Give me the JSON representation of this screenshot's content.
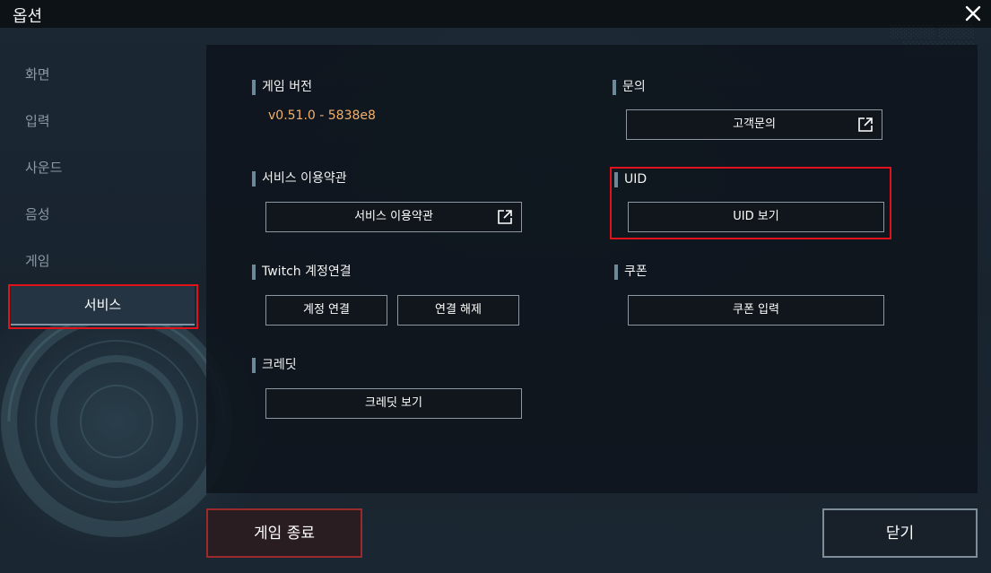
{
  "window": {
    "title": "옵션",
    "watermark_lines": [
      "░░░░░ ░░░░",
      "░░░░░░░░"
    ]
  },
  "sidebar": {
    "items": [
      {
        "label": "화면"
      },
      {
        "label": "입력"
      },
      {
        "label": "사운드"
      },
      {
        "label": "음성"
      },
      {
        "label": "게임"
      },
      {
        "label": "서비스",
        "active": true
      }
    ]
  },
  "main": {
    "game_version": {
      "label": "게임 버전",
      "value": "v0.51.0 - 5838e8"
    },
    "terms": {
      "label": "서비스 이용약관",
      "button": "서비스 이용약관"
    },
    "twitch": {
      "label": "Twitch 계정연결",
      "connect": "계정 연결",
      "disconnect": "연결 해제"
    },
    "credits": {
      "label": "크레딧",
      "button": "크레딧 보기"
    },
    "inquiry": {
      "label": "문의",
      "button": "고객문의"
    },
    "uid": {
      "label": "UID",
      "button": "UID 보기"
    },
    "coupon": {
      "label": "쿠폰",
      "button": "쿠폰 입력"
    }
  },
  "footer": {
    "quit": "게임 종료",
    "close": "닫기"
  },
  "colors": {
    "highlight": "#e0121b",
    "version_text": "#f3b06c",
    "accent_bar": "#6d8899"
  },
  "icons": {
    "close": "close-icon",
    "external_link": "external-link-icon"
  }
}
